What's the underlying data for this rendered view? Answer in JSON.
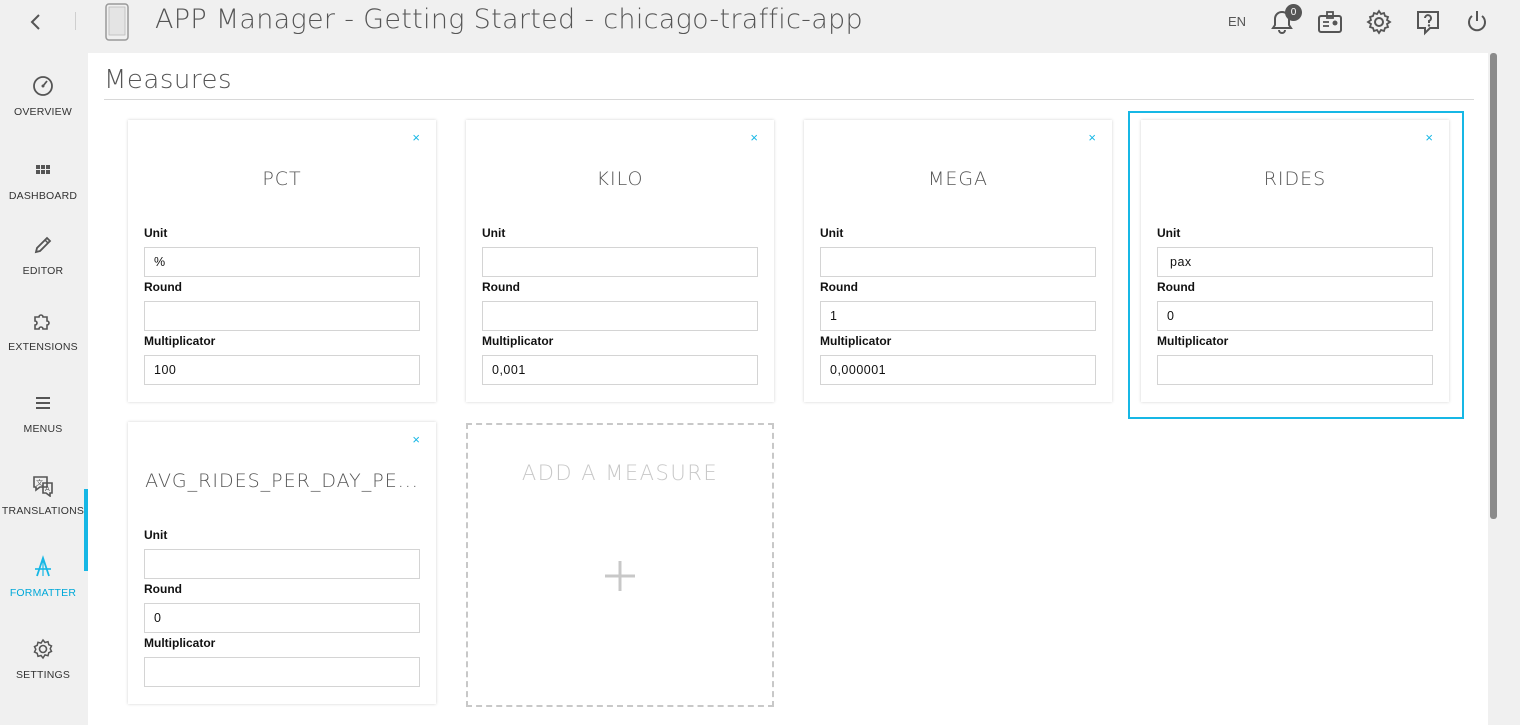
{
  "header": {
    "title": "APP Manager - Getting Started - chicago-traffic-app",
    "language": "EN",
    "notifications_count": "0",
    "icons": [
      "back-icon",
      "phone-icon",
      "bell-icon",
      "id-card-icon",
      "gear-icon",
      "help-icon",
      "power-icon"
    ]
  },
  "sidebar": {
    "items": [
      {
        "label": "OVERVIEW",
        "icon": "gauge-icon"
      },
      {
        "label": "DASHBOARD",
        "icon": "grid-icon"
      },
      {
        "label": "EDITOR",
        "icon": "pencil-icon"
      },
      {
        "label": "EXTENSIONS",
        "icon": "puzzle-icon"
      },
      {
        "label": "MENUS",
        "icon": "hamburger-icon"
      },
      {
        "label": "TRANSLATIONS",
        "icon": "translate-icon"
      },
      {
        "label": "FORMATTER",
        "icon": "formatter-icon"
      },
      {
        "label": "SETTINGS",
        "icon": "gear-icon"
      }
    ],
    "active": "FORMATTER",
    "accent_color": "#16b7e5"
  },
  "main": {
    "section_title": "Measures",
    "field_labels": {
      "unit": "Unit",
      "round": "Round",
      "multiplicator": "Multiplicator"
    },
    "close_symbol": "×",
    "measures": [
      {
        "name": "PCT",
        "unit": "%",
        "round": "",
        "multiplicator": "100"
      },
      {
        "name": "KILO",
        "unit": "",
        "round": "",
        "multiplicator": "0,001"
      },
      {
        "name": "MEGA",
        "unit": "",
        "round": "1",
        "multiplicator": "0,000001"
      },
      {
        "name": "RIDES",
        "unit": "pax",
        "round": "0",
        "multiplicator": "",
        "selected": true
      },
      {
        "name": "AVG_RIDES_PER_DAY_PE...",
        "unit": "",
        "round": "0",
        "multiplicator": ""
      }
    ],
    "add_label": "ADD A MEASURE",
    "add_symbol": "+"
  }
}
